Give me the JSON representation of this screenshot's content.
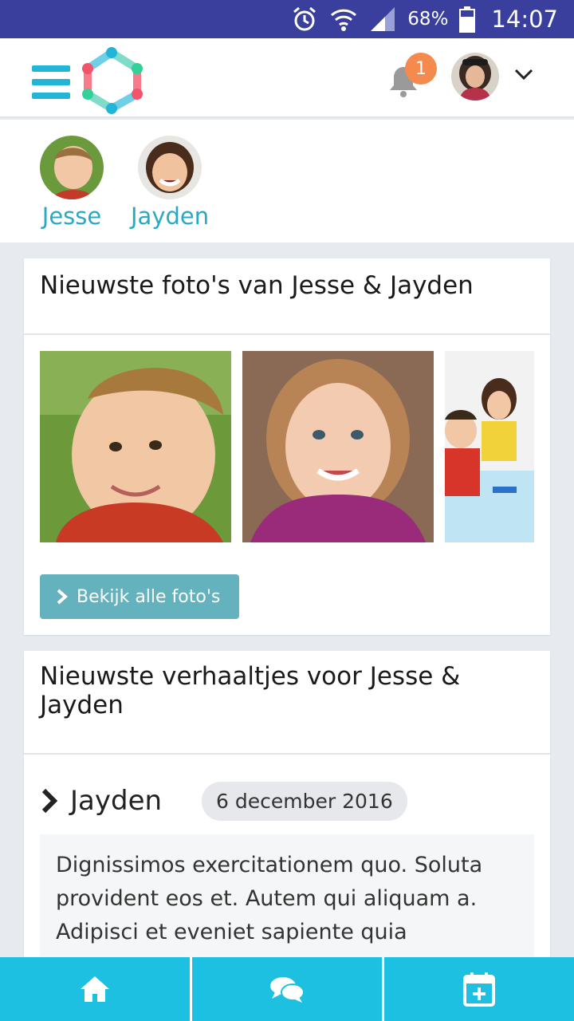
{
  "status_bar": {
    "battery": "68%",
    "time": "14:07"
  },
  "header": {
    "notification_count": "1"
  },
  "children": [
    {
      "name": "Jesse"
    },
    {
      "name": "Jayden"
    }
  ],
  "photos_card": {
    "title": "Nieuwste foto's van Jesse & Jayden",
    "button_label": "Bekijk alle foto's"
  },
  "stories_card": {
    "title": "Nieuwste verhaaltjes voor Jesse & Jayden",
    "story": {
      "child": "Jayden",
      "date": "6 december 2016",
      "text": "Dignissimos exercitationem quo. Soluta provident eos et. Autem qui aliquam a. Adipisci et eveniet sapiente quia"
    }
  },
  "colors": {
    "accent": "#22b5d8",
    "status_bar": "#3a3f9e",
    "button": "#63b2bd",
    "badge": "#f58a4f",
    "nav": "#1ec0e2"
  },
  "icons": [
    "alarm-icon",
    "wifi-icon",
    "signal-icon",
    "battery-icon",
    "menu-icon",
    "bell-icon",
    "chevron-down-icon",
    "chevron-right-icon",
    "home-icon",
    "chat-icon",
    "calendar-add-icon"
  ]
}
